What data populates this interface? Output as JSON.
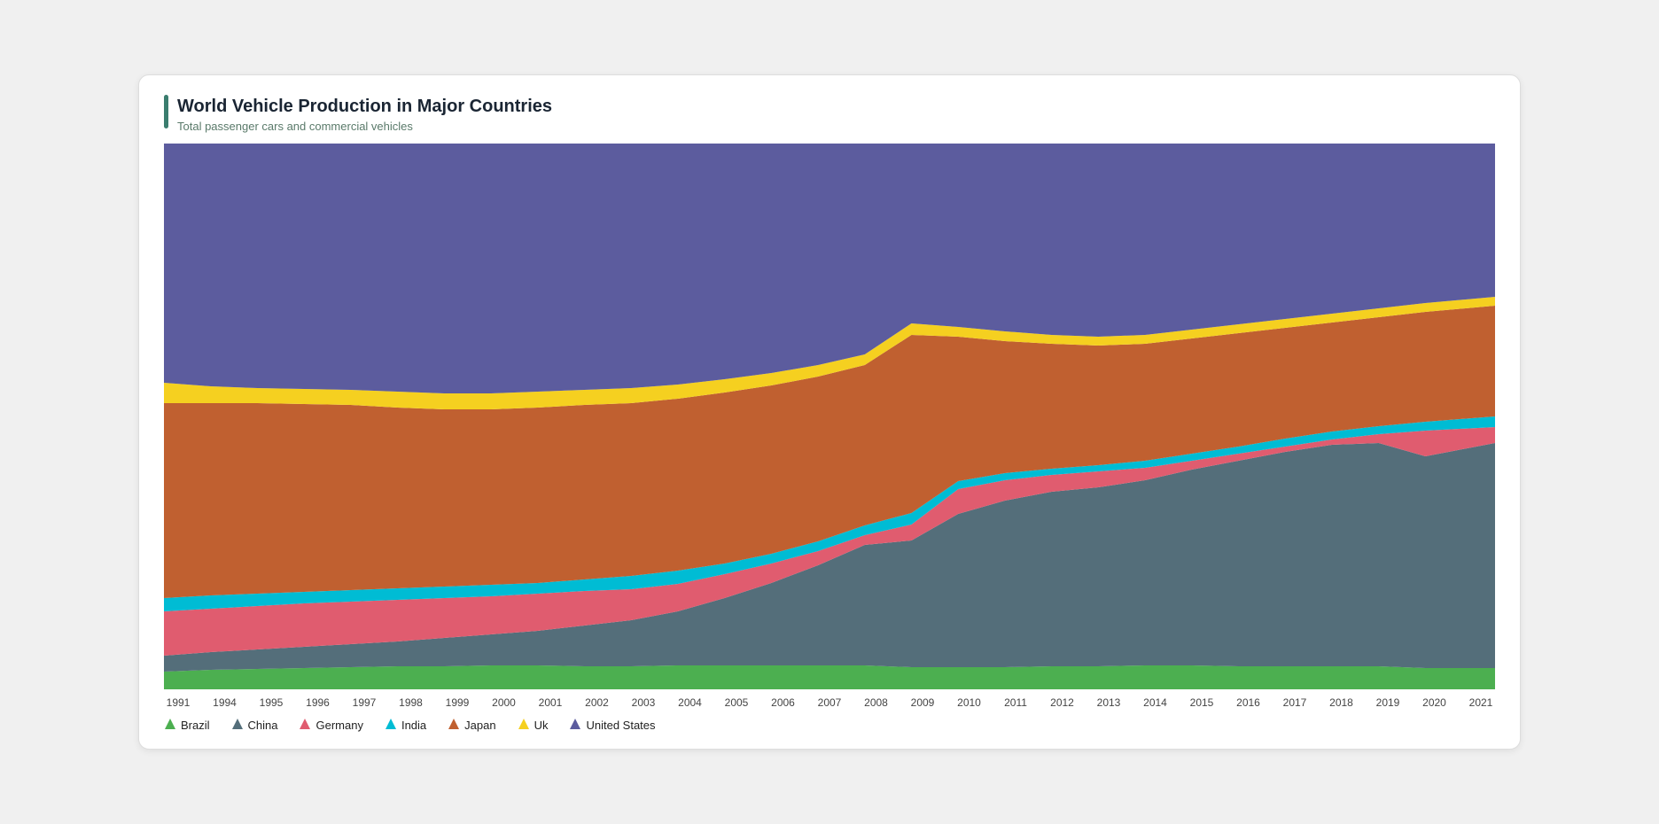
{
  "chart": {
    "title": "World Vehicle Production in Major Countries",
    "subtitle": "Total passenger cars and commercial vehicles"
  },
  "xAxis": {
    "labels": [
      "1991",
      "1994",
      "1995",
      "1996",
      "1997",
      "1998",
      "1999",
      "2000",
      "2001",
      "2002",
      "2003",
      "2004",
      "2005",
      "2006",
      "2007",
      "2008",
      "2009",
      "2010",
      "2011",
      "2012",
      "2013",
      "2014",
      "2015",
      "2016",
      "2017",
      "2018",
      "2019",
      "2020",
      "2021"
    ]
  },
  "legend": [
    {
      "label": "Brazil",
      "color": "#4caf50",
      "shape": "triangle-up"
    },
    {
      "label": "China",
      "color": "#546e7a",
      "shape": "triangle-up"
    },
    {
      "label": "Germany",
      "color": "#e05c6f",
      "shape": "triangle-up"
    },
    {
      "label": "India",
      "color": "#00bcd4",
      "shape": "triangle-up"
    },
    {
      "label": "Japan",
      "color": "#c06030",
      "shape": "triangle-up"
    },
    {
      "label": "Uk",
      "color": "#f5d020",
      "shape": "triangle-up"
    },
    {
      "label": "United States",
      "color": "#5c5c9e",
      "shape": "triangle-up"
    }
  ]
}
